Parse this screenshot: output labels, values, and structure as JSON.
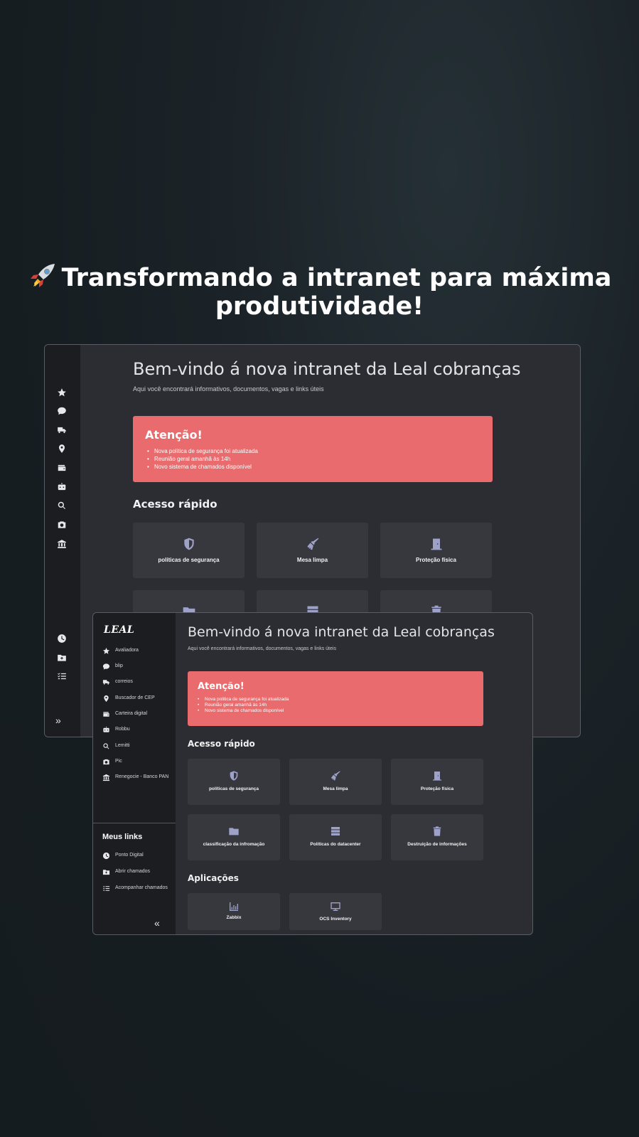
{
  "headline": {
    "line1": "Transformando a intranet para máxima",
    "line2": "produtividade!"
  },
  "back_window": {
    "title": "Bem-vindo á nova intranet da Leal cobranças",
    "subtitle": "Aqui você encontrará informativos, documentos, vagas e links úteis",
    "alert": {
      "title": "Atenção!",
      "items": [
        "Nova politica de segurança foi atualizada",
        "Reunião geral amanhã às 14h",
        "Novo sistema de chamados disponível"
      ]
    },
    "quick_access_title": "Acesso rápido",
    "cards": [
      "políticas de segurança",
      "Mesa limpa",
      "Proteção física"
    ],
    "sidebar_icons": [
      "star-icon",
      "chat-icon",
      "truck-icon",
      "map-pin-icon",
      "wallet-icon",
      "robot-icon",
      "search-icon",
      "camera-icon",
      "bank-icon",
      "clock-icon",
      "folder-plus-icon",
      "checklist-icon"
    ],
    "expand_label": "»"
  },
  "front_window": {
    "logo": "LEAL",
    "title": "Bem-vindo á nova intranet da Leal cobranças",
    "subtitle": "Aqui você encontrará informativos, documentos, vagas e links úteis",
    "alert": {
      "title": "Atenção!",
      "items": [
        "Nova politica de segurança foi atualizada",
        "Reunião geral amanhã às 14h",
        "Novo sistema de chamados disponível"
      ]
    },
    "nav": [
      {
        "label": "Avaliadora",
        "icon": "star-icon"
      },
      {
        "label": "blip",
        "icon": "chat-icon"
      },
      {
        "label": "correios",
        "icon": "truck-icon"
      },
      {
        "label": "Buscador de CEP",
        "icon": "map-pin-icon"
      },
      {
        "label": "Carteira digital",
        "icon": "wallet-icon"
      },
      {
        "label": "Robbu",
        "icon": "robot-icon"
      },
      {
        "label": "Lemitti",
        "icon": "search-icon"
      },
      {
        "label": "Pic",
        "icon": "camera-icon"
      },
      {
        "label": "Renegocie - Banco PAN",
        "icon": "bank-icon"
      }
    ],
    "links_title": "Meus links",
    "links": [
      {
        "label": "Ponto Digital",
        "icon": "clock-icon"
      },
      {
        "label": "Abrir chamados",
        "icon": "folder-plus-icon"
      },
      {
        "label": "Acompanhar chamados",
        "icon": "checklist-icon"
      }
    ],
    "quick_access_title": "Acesso rápido",
    "quick_cards": [
      {
        "label": "políticas de segurança",
        "icon": "shield-icon"
      },
      {
        "label": "Mesa limpa",
        "icon": "broom-icon"
      },
      {
        "label": "Proteção física",
        "icon": "door-icon"
      },
      {
        "label": "classificação da infromação",
        "icon": "folder-icon"
      },
      {
        "label": "Políticas do datacenter",
        "icon": "server-icon"
      },
      {
        "label": "Destruição de informações",
        "icon": "trash-icon"
      }
    ],
    "apps_title": "Aplicações",
    "apps": [
      {
        "label": "Zabbix",
        "icon": "chart-icon"
      },
      {
        "label": "OCS Inventory",
        "icon": "monitor-icon"
      }
    ],
    "collapse_label": "«"
  },
  "colors": {
    "alert": "#e96b6d",
    "icon_accent": "#9ea1c8",
    "sidebar": "#1c1d21",
    "panel": "#2c2d32",
    "card": "#37383e"
  }
}
